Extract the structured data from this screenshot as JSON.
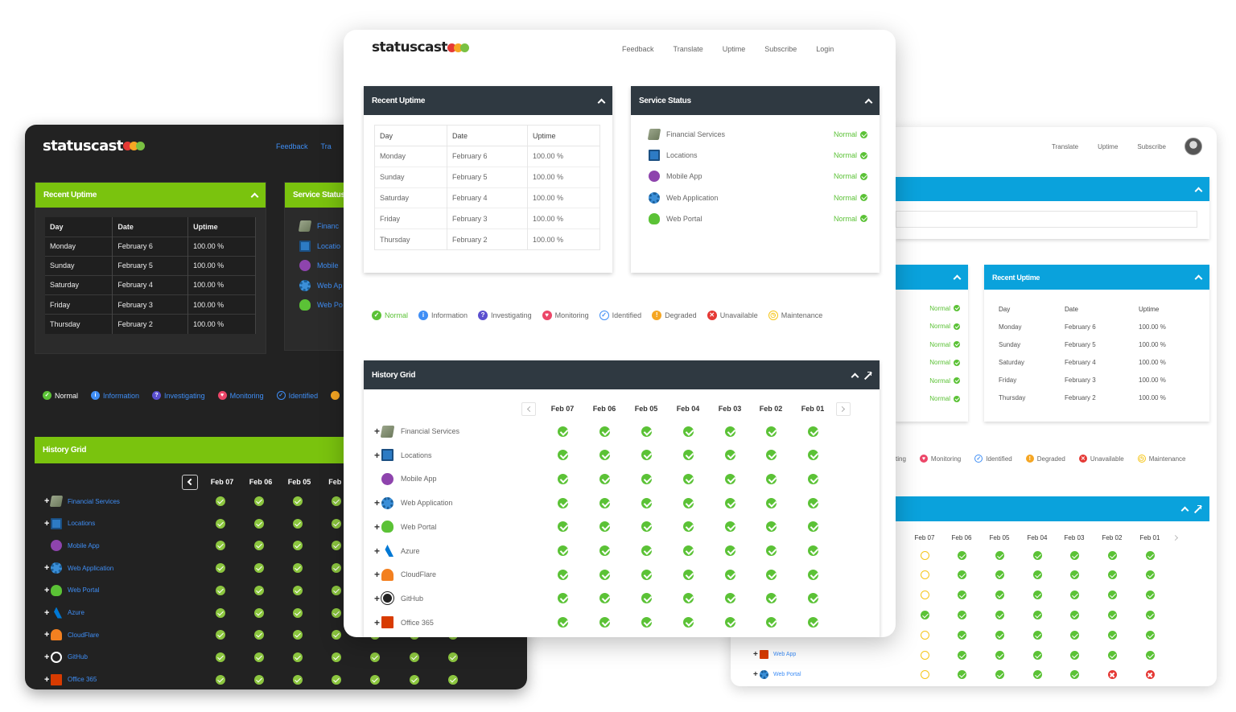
{
  "brand": {
    "name": "statuscast",
    "dot_colors": [
      "#e53935",
      "#f5a623",
      "#7ac142"
    ]
  },
  "colors": {
    "normal": "#5bc236",
    "dark_accent": "#7ac30e",
    "blue_accent": "#0aa2dc",
    "main_header": "#2f3941",
    "warning": "#f5c518",
    "unavailable": "#e53935",
    "link_blue": "#3f8ef5"
  },
  "main": {
    "nav": [
      "Feedback",
      "Translate",
      "Uptime",
      "Subscribe",
      "Login"
    ],
    "recent_uptime": {
      "title": "Recent Uptime",
      "columns": [
        "Day",
        "Date",
        "Uptime"
      ],
      "rows": [
        [
          "Monday",
          "February 6",
          "100.00 %"
        ],
        [
          "Sunday",
          "February 5",
          "100.00 %"
        ],
        [
          "Saturday",
          "February 4",
          "100.00 %"
        ],
        [
          "Friday",
          "February 3",
          "100.00 %"
        ],
        [
          "Thursday",
          "February 2",
          "100.00 %"
        ]
      ]
    },
    "service_status": {
      "title": "Service Status",
      "items": [
        {
          "name": "Financial Services",
          "status": "Normal",
          "icon": "money-icon"
        },
        {
          "name": "Locations",
          "status": "Normal",
          "icon": "building-icon"
        },
        {
          "name": "Mobile App",
          "status": "Normal",
          "icon": "mobile-icon"
        },
        {
          "name": "Web Application",
          "status": "Normal",
          "icon": "gear-icon"
        },
        {
          "name": "Web Portal",
          "status": "Normal",
          "icon": "portal-icon"
        }
      ]
    },
    "legend": [
      "Normal",
      "Information",
      "Investigating",
      "Monitoring",
      "Identified",
      "Degraded",
      "Unavailable",
      "Maintenance"
    ],
    "history_grid": {
      "title": "History Grid",
      "dates": [
        "Feb 07",
        "Feb 06",
        "Feb 05",
        "Feb 04",
        "Feb 03",
        "Feb 02",
        "Feb 01"
      ],
      "services": [
        {
          "name": "Financial Services",
          "icon": "money-icon",
          "expandable": true
        },
        {
          "name": "Locations",
          "icon": "building-icon",
          "expandable": true
        },
        {
          "name": "Mobile App",
          "icon": "mobile-icon",
          "expandable": false
        },
        {
          "name": "Web Application",
          "icon": "gear-icon",
          "expandable": true
        },
        {
          "name": "Web Portal",
          "icon": "portal-icon",
          "expandable": true
        },
        {
          "name": "Azure",
          "icon": "azure-icon",
          "expandable": true
        },
        {
          "name": "CloudFlare",
          "icon": "cloud-icon",
          "expandable": true
        },
        {
          "name": "GitHub",
          "icon": "github-icon",
          "expandable": true
        },
        {
          "name": "Office 365",
          "icon": "office-icon",
          "expandable": true
        }
      ]
    }
  },
  "dark": {
    "nav": [
      "Feedback",
      "Tra"
    ],
    "recent_uptime_title": "Recent Uptime",
    "service_status_title": "Service Status",
    "service_names": [
      "Financ",
      "Locatio",
      "Mobile",
      "Web Ap",
      "Web Po"
    ],
    "legend": [
      "Normal",
      "Information",
      "Investigating",
      "Monitoring",
      "Identified"
    ],
    "history_title": "History Grid",
    "dates": [
      "Feb 07",
      "Feb 06",
      "Feb 05",
      "Feb 0"
    ],
    "services": [
      "Financial Services",
      "Locations",
      "Mobile App",
      "Web Application",
      "Web Portal",
      "Azure",
      "CloudFlare",
      "GitHub",
      "Office 365"
    ]
  },
  "blue": {
    "nav": [
      "Translate",
      "Uptime",
      "Subscribe"
    ],
    "recent_uptime_title": "Recent Uptime",
    "status_values": [
      "Normal",
      "Normal",
      "Normal",
      "Normal",
      "Normal",
      "Normal"
    ],
    "legend": [
      "ting",
      "Monitoring",
      "Identified",
      "Degraded",
      "Unavailable",
      "Maintenance"
    ],
    "dates": [
      "Feb 07",
      "Feb 06",
      "Feb 05",
      "Feb 04",
      "Feb 03",
      "Feb 02",
      "Feb 01"
    ],
    "grid": [
      [
        "warn",
        "ok",
        "ok",
        "ok",
        "ok",
        "ok",
        "ok"
      ],
      [
        "warn",
        "ok",
        "ok",
        "ok",
        "ok",
        "ok",
        "ok"
      ],
      [
        "warn",
        "ok",
        "ok",
        "ok",
        "ok",
        "ok",
        "ok"
      ],
      [
        "ok",
        "ok",
        "ok",
        "ok",
        "ok",
        "ok",
        "ok"
      ],
      [
        "warn",
        "ok",
        "ok",
        "ok",
        "ok",
        "ok",
        "ok"
      ],
      [
        "warn",
        "ok",
        "ok",
        "ok",
        "ok",
        "ok",
        "ok"
      ],
      [
        "warn",
        "ok",
        "ok",
        "ok",
        "ok",
        "down",
        "down"
      ]
    ],
    "services": [
      "Web App",
      "Web Portal"
    ]
  }
}
